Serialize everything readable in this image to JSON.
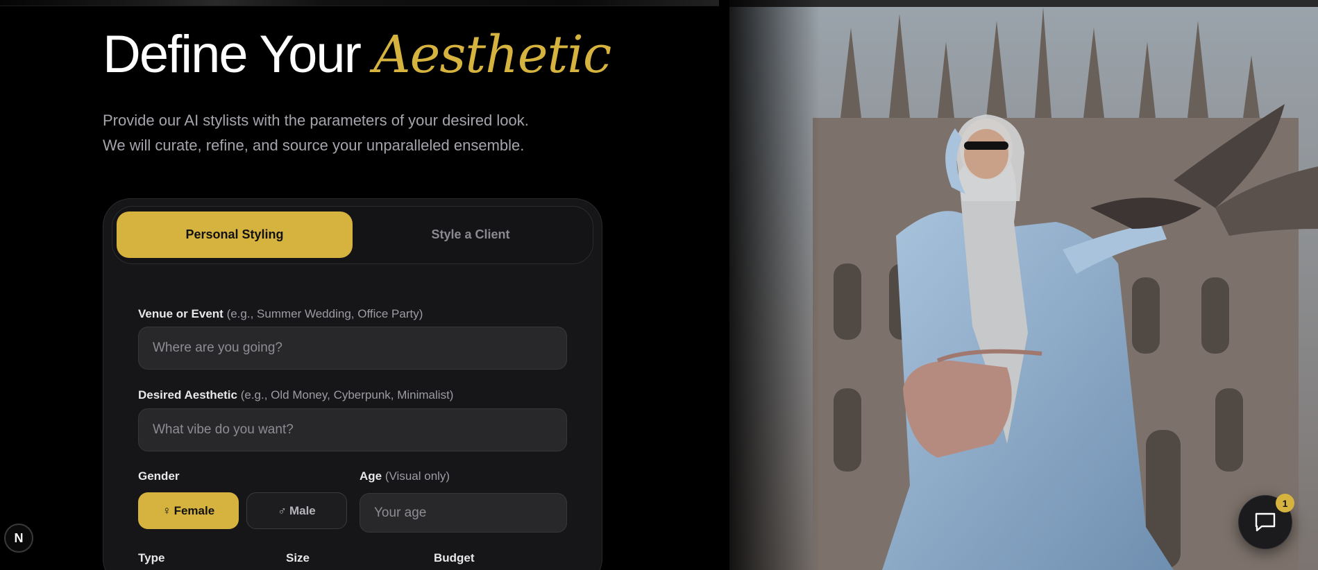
{
  "hero": {
    "title_main": "Define Your",
    "title_accent": "Aesthetic",
    "subtitle_line1": "Provide our AI stylists with the parameters of your desired look.",
    "subtitle_line2": "We will curate, refine, and source your unparalleled ensemble."
  },
  "tabs": [
    {
      "label": "Personal Styling",
      "active": true
    },
    {
      "label": "Style a Client",
      "active": false
    }
  ],
  "form": {
    "venue": {
      "label": "Venue or Event",
      "hint": "(e.g., Summer Wedding, Office Party)",
      "placeholder": "Where are you going?",
      "value": ""
    },
    "aesthetic": {
      "label": "Desired Aesthetic",
      "hint": "(e.g., Old Money, Cyberpunk, Minimalist)",
      "placeholder": "What vibe do you want?",
      "value": ""
    },
    "gender": {
      "label": "Gender",
      "options": [
        {
          "symbol": "♀",
          "label": "Female",
          "selected": true
        },
        {
          "symbol": "♂",
          "label": "Male",
          "selected": false
        }
      ]
    },
    "age": {
      "label": "Age",
      "hint": "(Visual only)",
      "placeholder": "Your age",
      "value": ""
    },
    "type_label": "Type",
    "size_label": "Size",
    "budget_label": "Budget"
  },
  "dev_badge": "N",
  "chat": {
    "icon": "chat-bubble-icon",
    "badge_count": "1"
  },
  "colors": {
    "accent": "#d6b23e",
    "background": "#000000",
    "card": "#161618"
  }
}
